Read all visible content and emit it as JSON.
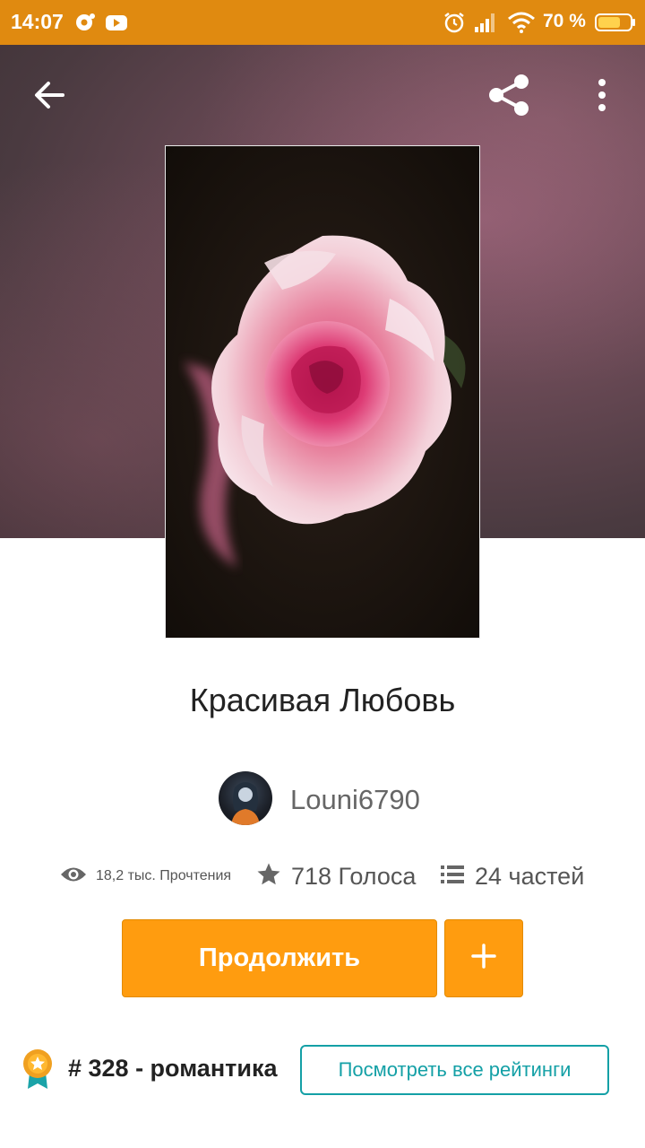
{
  "status_bar": {
    "time": "14:07",
    "battery_percent": "70 %",
    "battery_level": 0.7,
    "icons": [
      "notification-icon",
      "youtube-icon",
      "alarm-icon",
      "signal-icon",
      "wifi-icon",
      "battery-icon"
    ]
  },
  "toolbar": {
    "back_icon": "arrow-left-icon",
    "share_icon": "share-icon",
    "more_icon": "more-vertical-icon"
  },
  "story": {
    "title": "Красивая Любовь",
    "author": "Louni6790",
    "reads": "18,2 тыс. Прочтения",
    "votes": "718 Голоса",
    "parts": "24 частей"
  },
  "actions": {
    "continue_label": "Продолжить",
    "add_label": "+"
  },
  "ranking": {
    "text": "# 328 - романтика",
    "button_label": "Посмотреть все рейтинги"
  },
  "colors": {
    "status_bar": "#e08a10",
    "accent": "#ff9c0f",
    "teal": "#14a0a6"
  }
}
